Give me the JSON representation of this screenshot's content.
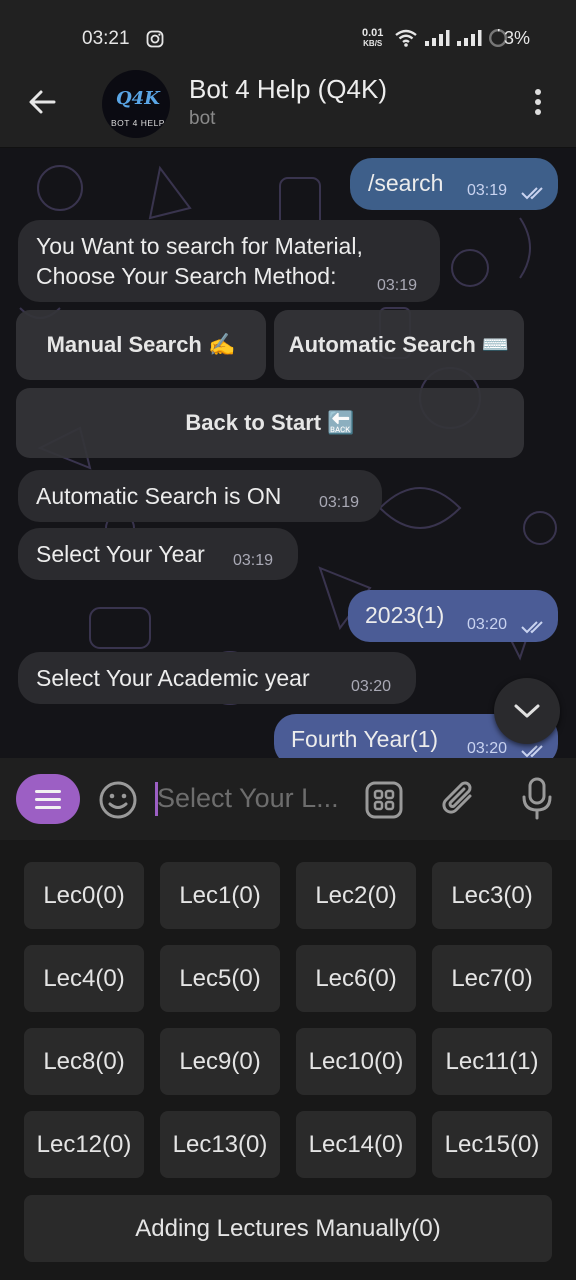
{
  "status": {
    "time": "03:21",
    "net_speed_value": "0.01",
    "net_speed_unit": "KB/S",
    "battery": "3%"
  },
  "header": {
    "title": "Bot 4 Help (Q4K)",
    "subtitle": "bot",
    "avatar_logo": "Q4K",
    "avatar_text": "BOT 4 HELP"
  },
  "messages": [
    {
      "dir": "out",
      "text": "/search",
      "time": "03:19"
    },
    {
      "dir": "in",
      "text_line1": "You Want to search for Material,",
      "text_line2": "Choose Your Search Method:",
      "time": "03:19"
    },
    {
      "dir": "in",
      "text": "Automatic Search is ON",
      "time": "03:19"
    },
    {
      "dir": "in",
      "text": "Select Your Year",
      "time": "03:19"
    },
    {
      "dir": "out",
      "text": "2023(1)",
      "time": "03:20"
    },
    {
      "dir": "in",
      "text": "Select Your Academic year",
      "time": "03:20"
    },
    {
      "dir": "out",
      "text": "Fourth Year(1)",
      "time": "03:20"
    }
  ],
  "inline_buttons": {
    "manual": "Manual Search ✍️",
    "automatic": "Automatic Search ⌨️",
    "back": "Back to Start 🔙"
  },
  "input": {
    "placeholder": "Select Your L..."
  },
  "keyboard": {
    "rows": [
      [
        "Lec0(0)",
        "Lec1(0)",
        "Lec2(0)",
        "Lec3(0)"
      ],
      [
        "Lec4(0)",
        "Lec5(0)",
        "Lec6(0)",
        "Lec7(0)"
      ],
      [
        "Lec8(0)",
        "Lec9(0)",
        "Lec10(0)",
        "Lec11(1)"
      ],
      [
        "Lec12(0)",
        "Lec13(0)",
        "Lec14(0)",
        "Lec15(0)"
      ]
    ],
    "wide": "Adding Lectures Manually(0)"
  },
  "colors": {
    "accent": "#9c5fc4",
    "outgoing_bubble": "#4b5c96",
    "incoming_bubble": "#2b2b2f",
    "background": "#141418"
  }
}
